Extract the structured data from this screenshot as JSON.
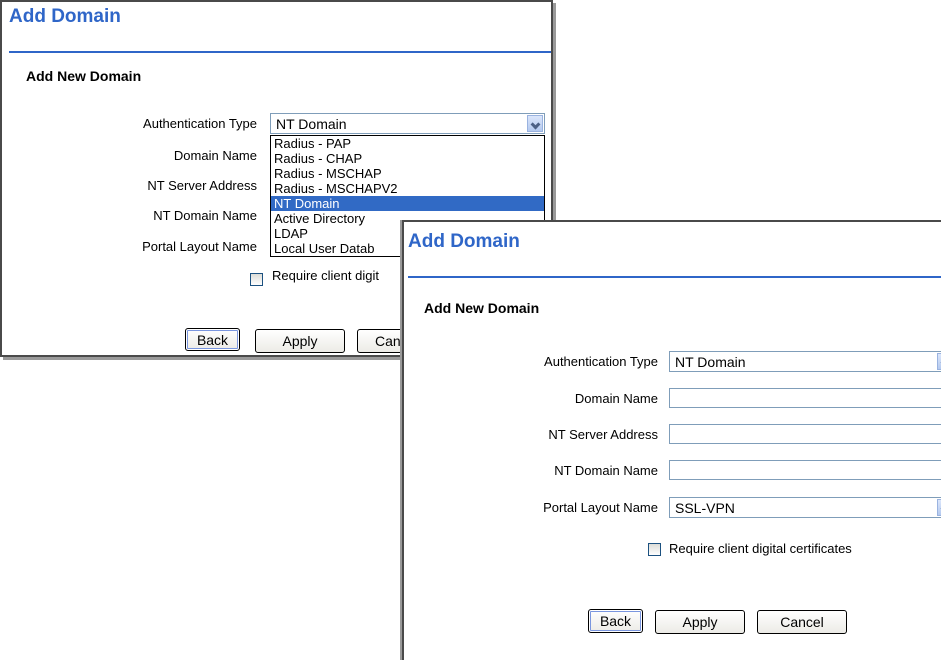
{
  "back_dialog": {
    "title": "Add Domain",
    "section": "Add New Domain",
    "labels": {
      "auth_type": "Authentication Type",
      "domain_name": "Domain Name",
      "nt_server": "NT Server Address",
      "nt_domain": "NT Domain Name",
      "portal_layout": "Portal Layout Name"
    },
    "auth_type_value": "NT Domain",
    "dropdown_options": [
      "Radius - PAP",
      "Radius - CHAP",
      "Radius - MSCHAP",
      "Radius - MSCHAPV2",
      "NT Domain",
      "Active Directory",
      "LDAP",
      "Local User Datab"
    ],
    "checkbox_label_fragment": "Require client digit",
    "buttons": {
      "back": "Back",
      "apply": "Apply",
      "cancel": "Can"
    }
  },
  "front_dialog": {
    "title": "Add Domain",
    "section": "Add New Domain",
    "labels": {
      "auth_type": "Authentication Type",
      "domain_name": "Domain Name",
      "nt_server": "NT Server Address",
      "nt_domain": "NT Domain Name",
      "portal_layout": "Portal Layout Name"
    },
    "auth_type_value": "NT Domain",
    "domain_name_value": "",
    "nt_server_value": "",
    "nt_domain_value": "",
    "portal_layout_value": "SSL-VPN",
    "checkbox_label": "Require client digital certificates",
    "buttons": {
      "back": "Back",
      "apply": "Apply",
      "cancel": "Cancel"
    }
  },
  "colors": {
    "title_blue": "#2f66c8",
    "selection_blue": "#316ac5",
    "field_border": "#7f9db9"
  }
}
